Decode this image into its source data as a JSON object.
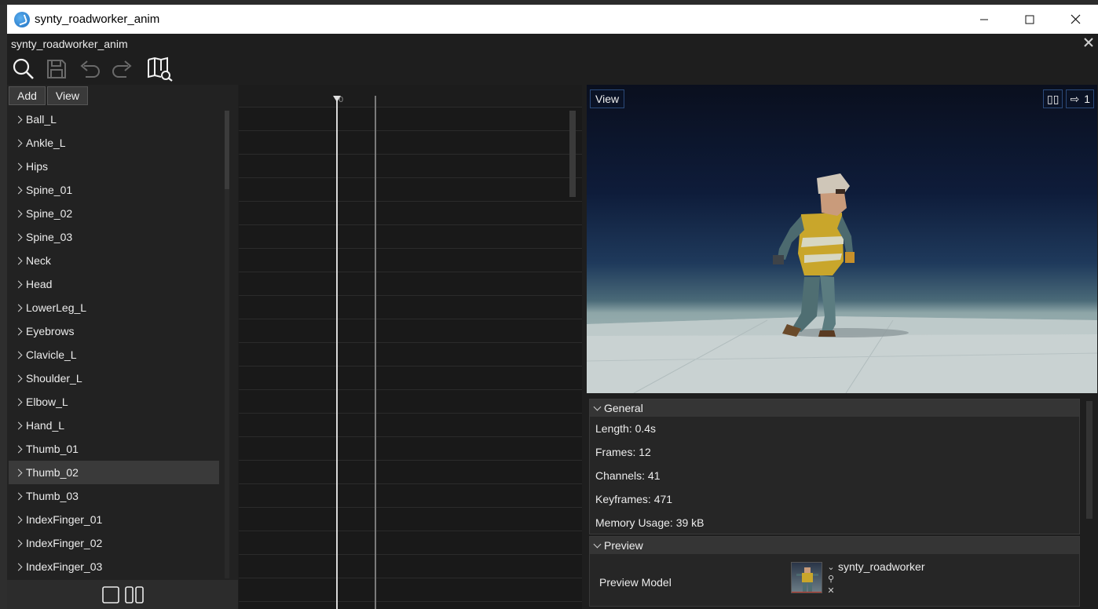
{
  "window": {
    "title": "synty_roadworker_anim",
    "minimize_glyph": "—",
    "maximize_glyph": "☐",
    "close_glyph": "✕"
  },
  "editor": {
    "title": "synty_roadworker_anim",
    "close_glyph": "✕",
    "toolbar": {
      "icons": [
        "search-icon",
        "save-icon",
        "undo-icon",
        "redo-icon",
        "docs-search-icon"
      ]
    }
  },
  "tree_panel": {
    "menu": {
      "add_label": "Add",
      "view_label": "View"
    },
    "items": [
      {
        "label": "Ball_L"
      },
      {
        "label": "Ankle_L"
      },
      {
        "label": "Hips"
      },
      {
        "label": "Spine_01"
      },
      {
        "label": "Spine_02"
      },
      {
        "label": "Spine_03"
      },
      {
        "label": "Neck"
      },
      {
        "label": "Head"
      },
      {
        "label": "LowerLeg_L"
      },
      {
        "label": "Eyebrows"
      },
      {
        "label": "Clavicle_L"
      },
      {
        "label": "Shoulder_L"
      },
      {
        "label": "Elbow_L"
      },
      {
        "label": "Hand_L"
      },
      {
        "label": "Thumb_01"
      },
      {
        "label": "Thumb_02"
      },
      {
        "label": "Thumb_03"
      },
      {
        "label": "IndexFinger_01"
      },
      {
        "label": "IndexFinger_02"
      },
      {
        "label": "IndexFinger_03"
      }
    ],
    "selected_label": "Thumb_02",
    "footer_icons": [
      "single-pane-icon",
      "split-pane-icon"
    ]
  },
  "timeline": {
    "current_frame_label": "0"
  },
  "viewport": {
    "view_label": "View",
    "pause_glyph": "▯▯",
    "speed_glyph": "⇨",
    "speed_value": "1",
    "background_colors": [
      "#0a0f1e",
      "#1f3a5c",
      "#b9c6c6"
    ]
  },
  "properties": {
    "general": {
      "header": "General",
      "length": "Length: 0.4s",
      "frames": "Frames: 12",
      "channels": "Channels: 41",
      "keyframes": "Keyframes: 471",
      "memory": "Memory Usage: 39 kB"
    },
    "preview": {
      "header": "Preview",
      "model_label": "Preview Model",
      "model_value": "synty_roadworker",
      "picker_glyph": "⌄",
      "find_glyph": "⚲",
      "clear_glyph": "✕"
    }
  }
}
